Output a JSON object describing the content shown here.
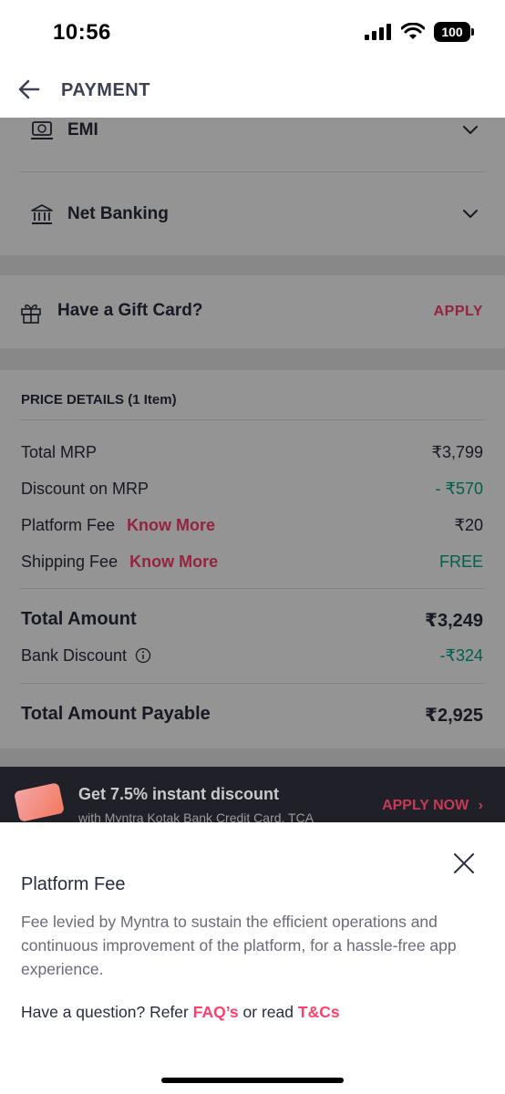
{
  "status_bar": {
    "time": "10:56",
    "battery": "100"
  },
  "header": {
    "title": "PAYMENT"
  },
  "payment_options": [
    {
      "label": "EMI",
      "icon": "emi-icon"
    },
    {
      "label": "Net Banking",
      "icon": "bank-icon"
    }
  ],
  "gift_card": {
    "label": "Have a Gift Card?",
    "action": "APPLY"
  },
  "price_details": {
    "title": "PRICE DETAILS (1 Item)",
    "total_mrp_label": "Total MRP",
    "total_mrp_value": "₹3,799",
    "discount_label": "Discount on MRP",
    "discount_value": "- ₹570",
    "platform_fee_label": "Platform Fee",
    "platform_fee_link": "Know More",
    "platform_fee_value": "₹20",
    "shipping_fee_label": "Shipping Fee",
    "shipping_fee_link": "Know More",
    "shipping_fee_value": "FREE",
    "total_amount_label": "Total Amount",
    "total_amount_value": "₹3,249",
    "bank_discount_label": "Bank Discount",
    "bank_discount_value": "-₹324",
    "payable_label": "Total Amount Payable",
    "payable_value": "₹2,925"
  },
  "offer_banner": {
    "title": "Get 7.5% instant discount",
    "subtitle": "with Myntra Kotak Bank Credit Card. TCA",
    "cta": "APPLY NOW"
  },
  "sheet": {
    "title": "Platform Fee",
    "description": "Fee levied by Myntra to sustain the efficient operations and continuous improvement of the platform, for a hassle-free app experience.",
    "question_prefix": "Have a question? Refer",
    "faq_link": "FAQ’s",
    "question_mid": "or read",
    "tnc_link": "T&Cs"
  },
  "colors": {
    "accent": "#ff3f6c",
    "green": "#03a685",
    "text": "#282c3f"
  }
}
